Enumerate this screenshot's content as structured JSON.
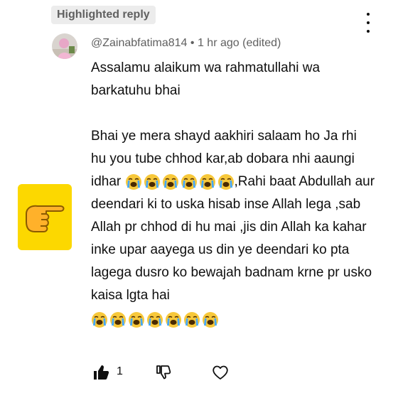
{
  "chip": {
    "label": "Highlighted reply"
  },
  "comment": {
    "author": "@Zainabfatima814",
    "separator": "•",
    "time": "1 hr ago (edited)",
    "line1": "Assalamu alaikum wa rahmatullahi wa barkatuhu bhai",
    "p2a": "Bhai ye mera shayd aakhiri salaam ho Ja rhi hu you tube chhod kar,ab dobara nhi aaungi idhar",
    "p2b": ",Rahi baat Abdullah aur deendari ki to uska hisab inse Allah lega ,sab Allah pr chhod di hu mai ,jis din Allah ka kahar inke upar aayega us din ye deendari ko pta lagega dusro ko bewajah badnam krne pr usko kaisa lgta hai",
    "emoji_row1_count": 6,
    "emoji_row2_count": 7,
    "emoji_name": "loudly-crying-face-emoji"
  },
  "actions": {
    "like_count": "1"
  },
  "colors": {
    "chip_bg": "#ececec",
    "hand_bg": "#fcd800",
    "muted_text": "#606060"
  }
}
